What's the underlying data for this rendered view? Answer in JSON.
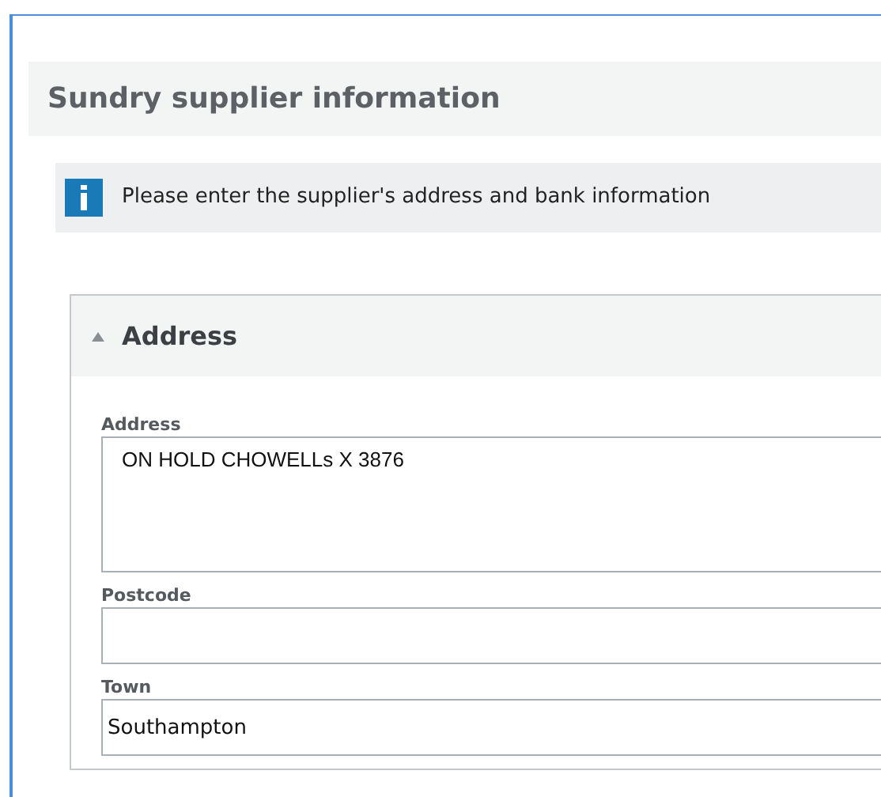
{
  "title": "Sundry supplier information",
  "info": "Please enter the supplier's address and bank information",
  "section": {
    "title": "Address",
    "expanded": true,
    "fields": [
      {
        "kind": "textarea",
        "label": "Address",
        "value": "ON HOLD CHOWELLs X 3876"
      },
      {
        "kind": "input",
        "label": "Postcode"
      },
      {
        "kind": "input",
        "label": "Town",
        "value": "Southampton"
      }
    ]
  }
}
